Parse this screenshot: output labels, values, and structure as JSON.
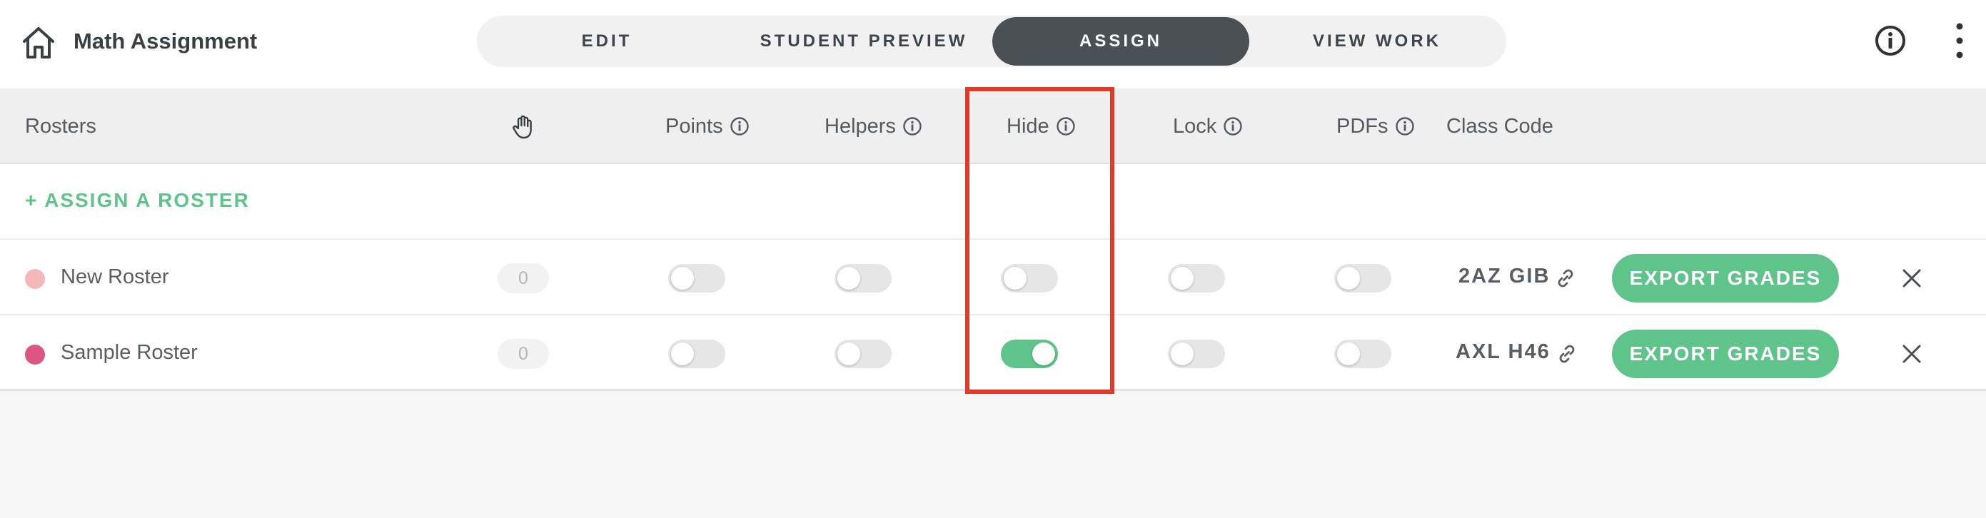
{
  "header": {
    "title": "Math Assignment",
    "home_icon": "home-icon",
    "info_icon": "info-circle-icon",
    "more_icon": "more-vertical-icon",
    "tabs": [
      {
        "label": "EDIT",
        "active": false
      },
      {
        "label": "STUDENT PREVIEW",
        "active": false
      },
      {
        "label": "ASSIGN",
        "active": true
      },
      {
        "label": "VIEW WORK",
        "active": false
      }
    ]
  },
  "table": {
    "columns": {
      "rosters": "Rosters",
      "hand_icon": "raised-hand-icon",
      "points": "Points",
      "helpers": "Helpers",
      "hide": "Hide",
      "lock": "Lock",
      "pdfs": "PDFs",
      "class_code": "Class Code"
    },
    "assign_roster_label": "+ ASSIGN A ROSTER",
    "rows": [
      {
        "name": "New Roster",
        "dot_color": "#f3b8b8",
        "count": "0",
        "points": false,
        "helpers": false,
        "hide": false,
        "lock": false,
        "pdfs": false,
        "class_code": "2AZ GIB",
        "export_label": "EXPORT GRADES"
      },
      {
        "name": "Sample Roster",
        "dot_color": "#dd5582",
        "count": "0",
        "points": false,
        "helpers": false,
        "hide": true,
        "lock": false,
        "pdfs": false,
        "class_code": "AXL H46",
        "export_label": "EXPORT GRADES"
      }
    ]
  },
  "colors": {
    "accent_green": "#5ec48a",
    "active_tab": "#4b5054",
    "highlight": "#e03b2a"
  }
}
